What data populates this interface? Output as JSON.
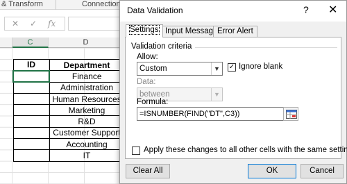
{
  "excel": {
    "ribbon": {
      "transform_group": "& Transform",
      "connections_group": "Connections"
    },
    "formula_bar": {
      "cancel_glyph": "✕",
      "enter_glyph": "✓",
      "fx_glyph": "fx"
    },
    "columns": {
      "c": "C",
      "d": "D"
    },
    "table": {
      "headers": {
        "id": "ID",
        "department": "Department"
      },
      "departments": [
        "Finance",
        "Administration",
        "Human Resources",
        "Marketing",
        "R&D",
        "Customer Support",
        "Accounting",
        "IT"
      ]
    },
    "colors": {
      "selection": "#217346"
    }
  },
  "dialog": {
    "title": "Data Validation",
    "help_glyph": "?",
    "close_glyph": "✕",
    "tabs": [
      {
        "label": "Settings"
      },
      {
        "label": "Input Message"
      },
      {
        "label": "Error Alert"
      }
    ],
    "validation_criteria_label": "Validation criteria",
    "allow": {
      "label": "Allow:",
      "value": "Custom"
    },
    "ignore_blank": {
      "label": "Ignore blank",
      "checked": true
    },
    "data": {
      "label": "Data:",
      "value": "between"
    },
    "formula": {
      "label": "Formula:",
      "value": "=ISNUMBER(FIND(\"DT\",C3))"
    },
    "apply_all": {
      "label": "Apply these changes to all other cells with the same settings",
      "checked": false
    },
    "buttons": {
      "clear_all": "Clear All",
      "ok": "OK",
      "cancel": "Cancel"
    },
    "colors": {
      "default_button_border": "#0078d7"
    }
  }
}
